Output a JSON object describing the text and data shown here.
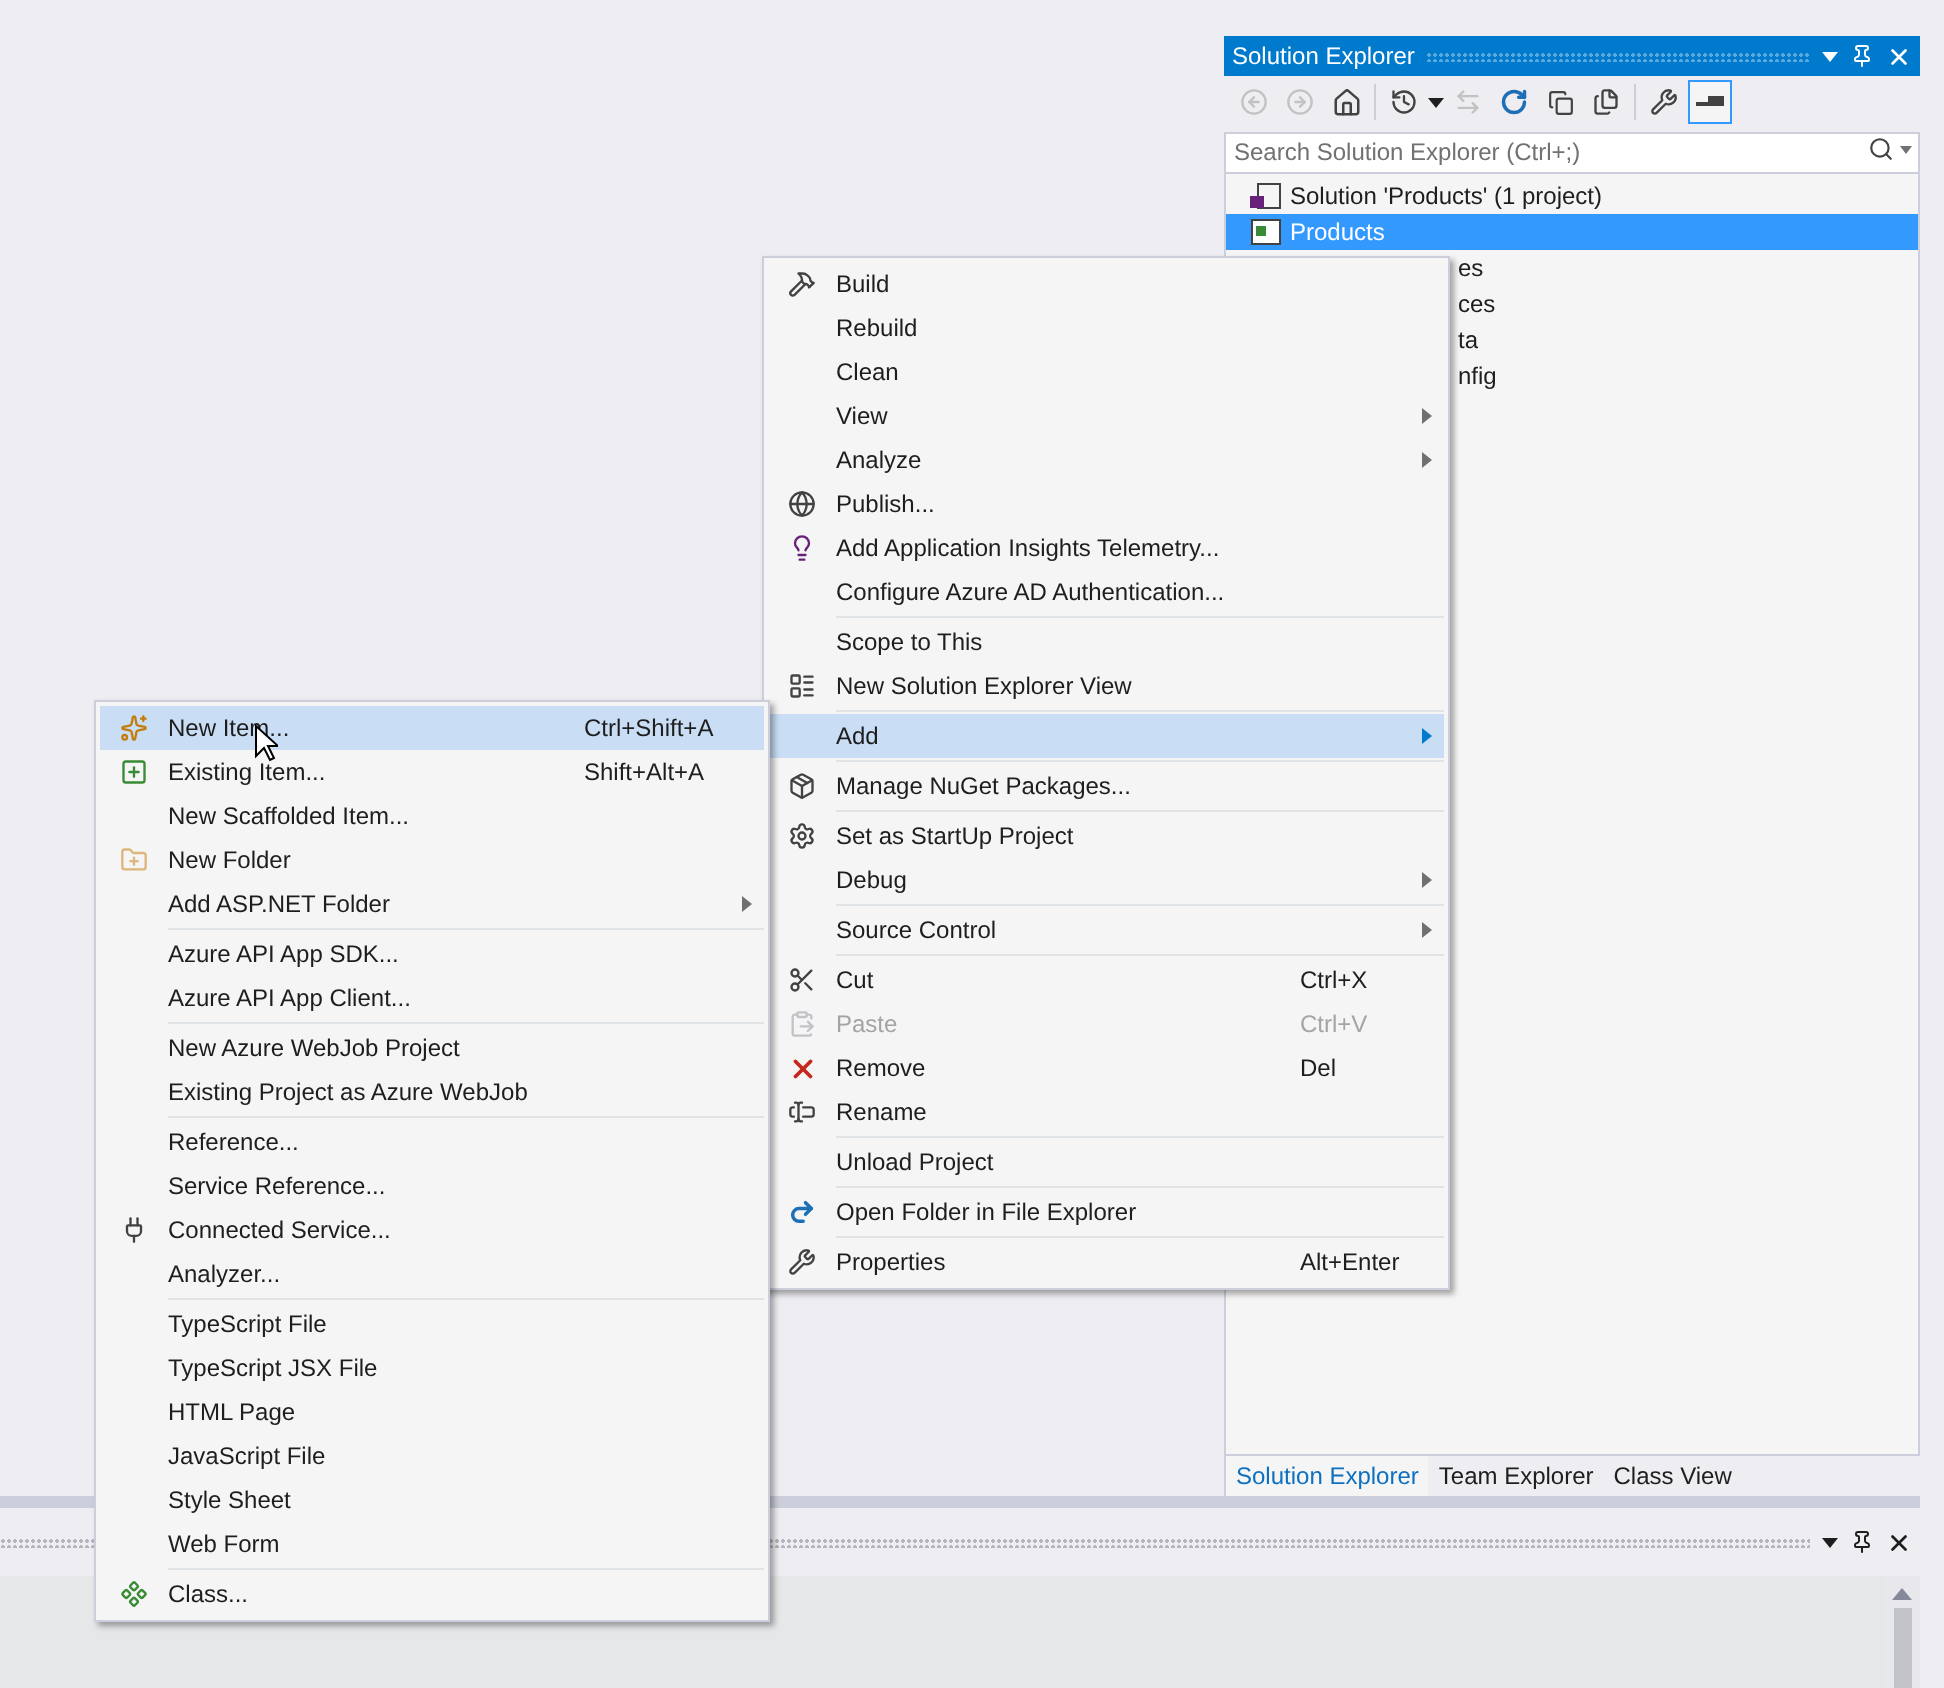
{
  "solution_explorer": {
    "title": "Solution Explorer",
    "search": {
      "placeholder": "Search Solution Explorer (Ctrl+;)"
    },
    "tree": [
      {
        "label": "Solution 'Products' (1 project)",
        "selected": false,
        "children": [
          {
            "label": "Products",
            "selected": true,
            "children": [
              {
                "label": "es",
                "selected": false
              },
              {
                "label": "ces",
                "selected": false
              },
              {
                "label": "ta",
                "selected": false
              },
              {
                "label": "nfig",
                "selected": false
              }
            ]
          }
        ]
      }
    ],
    "tabs": [
      {
        "label": "Solution Explorer",
        "selected": true
      },
      {
        "label": "Team Explorer",
        "selected": false
      },
      {
        "label": "Class View",
        "selected": false
      }
    ]
  },
  "context_menu": {
    "groups": [
      {
        "items": [
          {
            "label": "Build",
            "selected": false,
            "disabled": false,
            "submenu": false
          },
          {
            "label": "Rebuild",
            "selected": false,
            "disabled": false,
            "submenu": false
          },
          {
            "label": "Clean",
            "selected": false,
            "disabled": false,
            "submenu": false
          },
          {
            "label": "View",
            "selected": false,
            "disabled": false,
            "submenu": true
          },
          {
            "label": "Analyze",
            "selected": false,
            "disabled": false,
            "submenu": true
          },
          {
            "label": "Publish...",
            "selected": false,
            "disabled": false,
            "submenu": false
          },
          {
            "label": "Add Application Insights Telemetry...",
            "selected": false,
            "disabled": false,
            "submenu": false
          },
          {
            "label": "Configure Azure AD Authentication...",
            "selected": false,
            "disabled": false,
            "submenu": false
          }
        ]
      },
      {
        "items": [
          {
            "label": "Scope to This",
            "selected": false,
            "disabled": false,
            "submenu": false
          },
          {
            "label": "New Solution Explorer View",
            "selected": false,
            "disabled": false,
            "submenu": false
          }
        ]
      },
      {
        "items": [
          {
            "label": "Add",
            "selected": true,
            "disabled": false,
            "submenu": true
          }
        ]
      },
      {
        "items": [
          {
            "label": "Manage NuGet Packages...",
            "selected": false,
            "disabled": false,
            "submenu": false
          }
        ]
      },
      {
        "items": [
          {
            "label": "Set as StartUp Project",
            "selected": false,
            "disabled": false,
            "submenu": false
          },
          {
            "label": "Debug",
            "selected": false,
            "disabled": false,
            "submenu": true
          }
        ]
      },
      {
        "items": [
          {
            "label": "Source Control",
            "selected": false,
            "disabled": false,
            "submenu": true
          }
        ]
      },
      {
        "items": [
          {
            "label": "Cut",
            "shortcut": "Ctrl+X",
            "selected": false,
            "disabled": false,
            "submenu": false
          },
          {
            "label": "Paste",
            "shortcut": "Ctrl+V",
            "selected": false,
            "disabled": true,
            "submenu": false
          },
          {
            "label": "Remove",
            "shortcut": "Del",
            "selected": false,
            "disabled": false,
            "submenu": false
          },
          {
            "label": "Rename",
            "selected": false,
            "disabled": false,
            "submenu": false
          }
        ]
      },
      {
        "items": [
          {
            "label": "Unload Project",
            "selected": false,
            "disabled": false,
            "submenu": false
          }
        ]
      },
      {
        "items": [
          {
            "label": "Open Folder in File Explorer",
            "selected": false,
            "disabled": false,
            "submenu": false
          }
        ]
      },
      {
        "items": [
          {
            "label": "Properties",
            "shortcut": "Alt+Enter",
            "selected": false,
            "disabled": false,
            "submenu": false
          }
        ]
      }
    ]
  },
  "add_submenu": {
    "groups": [
      {
        "items": [
          {
            "label": "New Item...",
            "shortcut": "Ctrl+Shift+A",
            "selected": true,
            "disabled": false,
            "submenu": false
          },
          {
            "label": "Existing Item...",
            "shortcut": "Shift+Alt+A",
            "selected": false,
            "disabled": false,
            "submenu": false
          },
          {
            "label": "New Scaffolded Item...",
            "selected": false,
            "disabled": false,
            "submenu": false
          },
          {
            "label": "New Folder",
            "selected": false,
            "disabled": false,
            "submenu": false
          },
          {
            "label": "Add ASP.NET Folder",
            "selected": false,
            "disabled": false,
            "submenu": true
          }
        ]
      },
      {
        "items": [
          {
            "label": "Azure API App SDK...",
            "selected": false,
            "disabled": false,
            "submenu": false
          },
          {
            "label": "Azure API App Client...",
            "selected": false,
            "disabled": false,
            "submenu": false
          }
        ]
      },
      {
        "items": [
          {
            "label": "New Azure WebJob Project",
            "selected": false,
            "disabled": false,
            "submenu": false
          },
          {
            "label": "Existing Project as Azure WebJob",
            "selected": false,
            "disabled": false,
            "submenu": false
          }
        ]
      },
      {
        "items": [
          {
            "label": "Reference...",
            "selected": false,
            "disabled": false,
            "submenu": false
          },
          {
            "label": "Service Reference...",
            "selected": false,
            "disabled": false,
            "submenu": false
          },
          {
            "label": "Connected Service...",
            "selected": false,
            "disabled": false,
            "submenu": false
          },
          {
            "label": "Analyzer...",
            "selected": false,
            "disabled": false,
            "submenu": false
          }
        ]
      },
      {
        "items": [
          {
            "label": "TypeScript File",
            "selected": false,
            "disabled": false,
            "submenu": false
          },
          {
            "label": "TypeScript JSX File",
            "selected": false,
            "disabled": false,
            "submenu": false
          },
          {
            "label": "HTML Page",
            "selected": false,
            "disabled": false,
            "submenu": false
          },
          {
            "label": "JavaScript File",
            "selected": false,
            "disabled": false,
            "submenu": false
          },
          {
            "label": "Style Sheet",
            "selected": false,
            "disabled": false,
            "submenu": false
          },
          {
            "label": "Web Form",
            "selected": false,
            "disabled": false,
            "submenu": false
          }
        ]
      },
      {
        "items": [
          {
            "label": "Class...",
            "selected": false,
            "disabled": false,
            "submenu": false
          }
        ]
      }
    ]
  }
}
